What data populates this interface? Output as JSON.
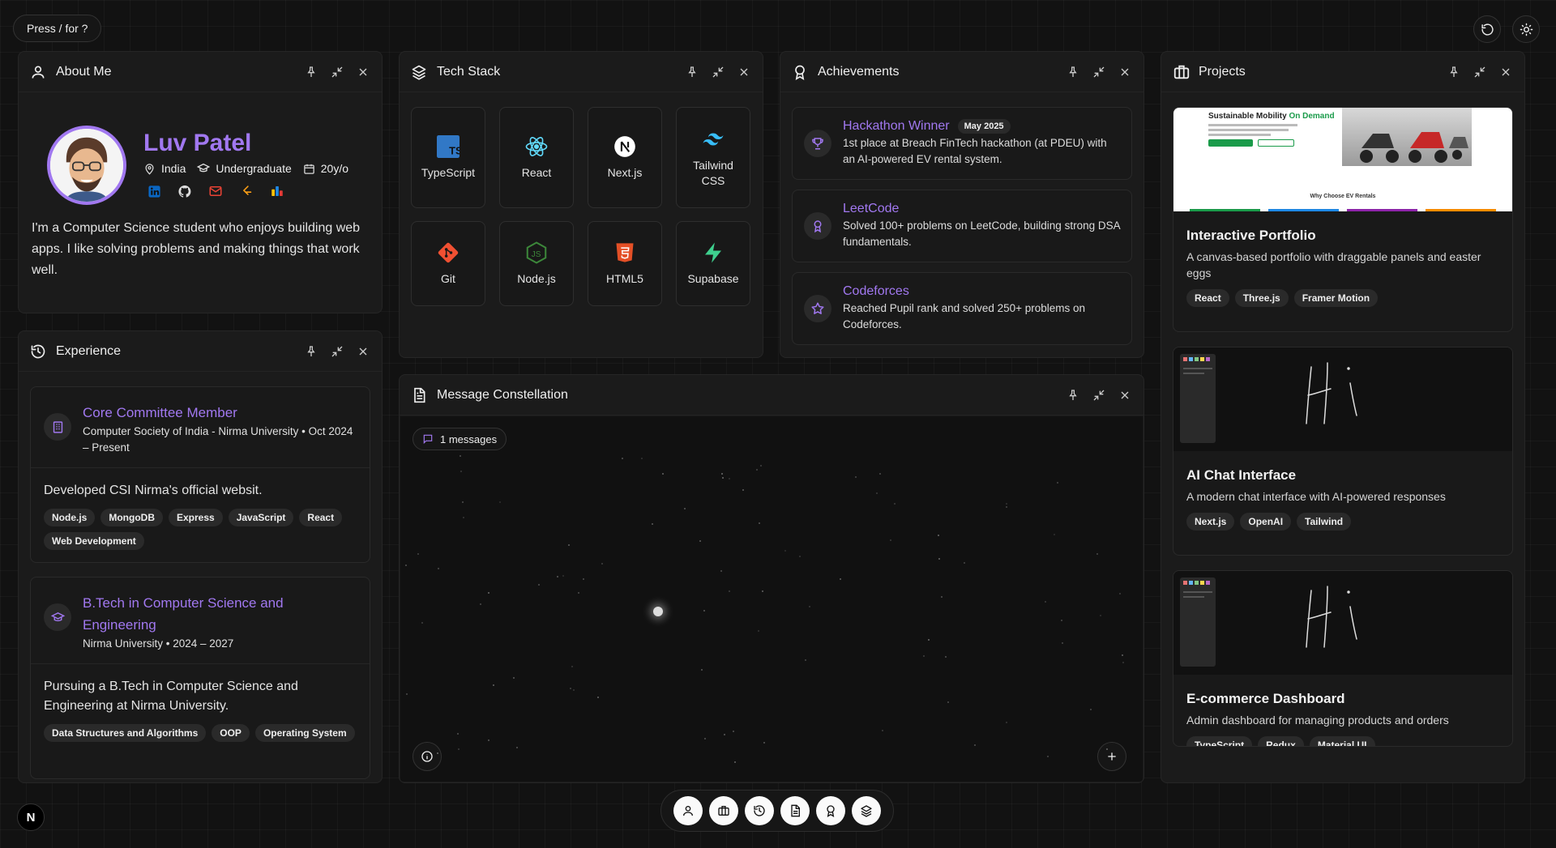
{
  "hint": "Press / for ?",
  "about": {
    "title": "About Me",
    "name": "Luv Patel",
    "location": "India",
    "level": "Undergraduate",
    "age": "20y/o",
    "bio": "I'm a Computer Science student who enjoys building web apps. I like solving problems and making things that work well."
  },
  "tech": {
    "title": "Tech Stack",
    "items": [
      {
        "label": "TypeScript"
      },
      {
        "label": "React"
      },
      {
        "label": "Next.js"
      },
      {
        "label": "Tailwind CSS"
      },
      {
        "label": "Git"
      },
      {
        "label": "Node.js"
      },
      {
        "label": "HTML5"
      },
      {
        "label": "Supabase"
      }
    ]
  },
  "achievements": {
    "title": "Achievements",
    "items": [
      {
        "title": "Hackathon Winner",
        "badge": "May 2025",
        "desc": "1st place at Breach FinTech hackathon (at PDEU) with an AI-powered EV rental system."
      },
      {
        "title": "LeetCode",
        "desc": "Solved 100+ problems on LeetCode, building strong DSA fundamentals."
      },
      {
        "title": "Codeforces",
        "desc": "Reached Pupil rank and solved 250+ problems on Codeforces."
      }
    ]
  },
  "projects": {
    "title": "Projects",
    "items": [
      {
        "title": "Interactive Portfolio",
        "desc": "A canvas-based portfolio with draggable panels and easter eggs",
        "tags": [
          "React",
          "Three.js",
          "Framer Motion"
        ],
        "thumb_heading": "Sustainable Mobility ",
        "thumb_heading_accent": "On Demand",
        "thumb_sub": "Why Choose EV Rentals"
      },
      {
        "title": "AI Chat Interface",
        "desc": "A modern chat interface with AI-powered responses",
        "tags": [
          "Next.js",
          "OpenAI",
          "Tailwind"
        ]
      },
      {
        "title": "E-commerce Dashboard",
        "desc": "Admin dashboard for managing products and orders",
        "tags": [
          "TypeScript",
          "Redux",
          "Material UI"
        ]
      }
    ]
  },
  "experience": {
    "title": "Experience",
    "items": [
      {
        "title": "Core Committee Member",
        "sub": "Computer Society of India - Nirma University • Oct 2024 – Present",
        "text": "Developed CSI Nirma's official websit.",
        "tags": [
          "Node.js",
          "MongoDB",
          "Express",
          "JavaScript",
          "React",
          "Web Development"
        ]
      },
      {
        "title": "B.Tech in Computer Science and Engineering",
        "sub": "Nirma University • 2024 – 2027",
        "text": "Pursuing a B.Tech in Computer Science and Engineering at Nirma University.",
        "tags": [
          "Data Structures and Algorithms",
          "OOP",
          "Operating System"
        ]
      }
    ]
  },
  "messages": {
    "title": "Message Constellation",
    "count": "1 messages"
  },
  "colors": {
    "accent": "#a178f0",
    "background": "#121212",
    "panel": "#1b1b1b"
  },
  "n_badge": "N"
}
